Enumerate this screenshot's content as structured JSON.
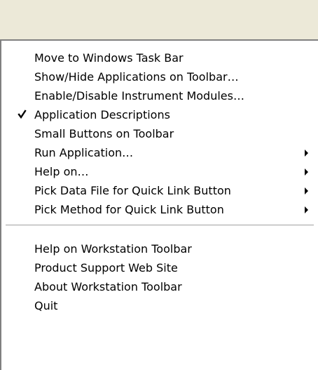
{
  "menu": {
    "groups": [
      {
        "items": [
          {
            "label": "Move to Windows Task Bar",
            "checked": false,
            "submenu": false
          },
          {
            "label": "Show/Hide Applications on Toolbar…",
            "checked": false,
            "submenu": false
          },
          {
            "label": "Enable/Disable Instrument Modules…",
            "checked": false,
            "submenu": false
          },
          {
            "label": "Application Descriptions",
            "checked": true,
            "submenu": false
          },
          {
            "label": "Small Buttons on Toolbar",
            "checked": false,
            "submenu": false
          },
          {
            "label": "Run Application…",
            "checked": false,
            "submenu": true
          },
          {
            "label": "Help on…",
            "checked": false,
            "submenu": true
          },
          {
            "label": "Pick Data File for Quick Link Button",
            "checked": false,
            "submenu": true
          },
          {
            "label": "Pick Method for Quick Link Button",
            "checked": false,
            "submenu": true
          }
        ]
      },
      {
        "items": [
          {
            "label": "Help on Workstation Toolbar",
            "checked": false,
            "submenu": false
          },
          {
            "label": "Product Support Web Site",
            "checked": false,
            "submenu": false
          },
          {
            "label": "About Workstation Toolbar",
            "checked": false,
            "submenu": false
          },
          {
            "label": "Quit",
            "checked": false,
            "submenu": false
          }
        ]
      }
    ]
  }
}
